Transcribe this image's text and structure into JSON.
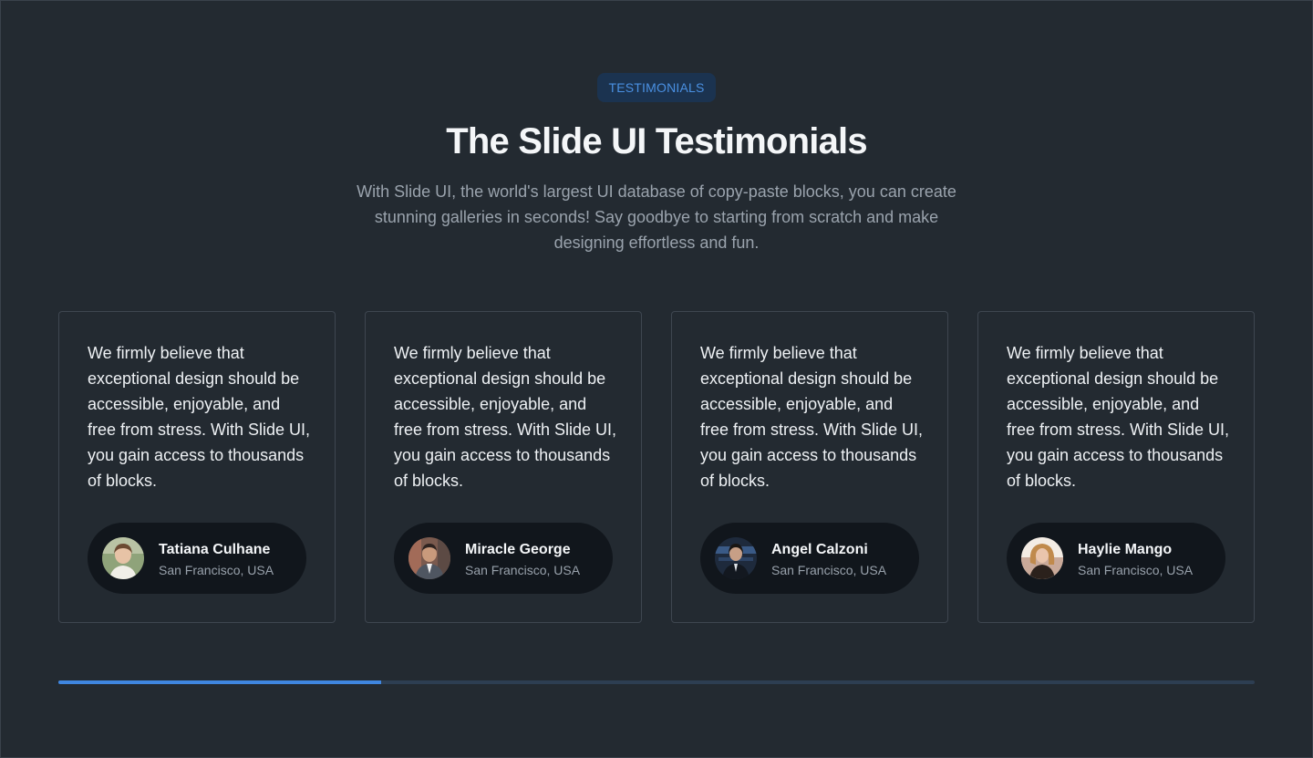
{
  "section": {
    "badge": "TESTIMONIALS",
    "title": "The Slide UI Testimonials",
    "subtitle": "With Slide UI, the world's largest UI database of copy-paste blocks, you can create stunning galleries in seconds! Say goodbye to starting from scratch and make designing effortless and fun."
  },
  "testimonials": [
    {
      "quote": "We firmly believe that exceptional design should be accessible, enjoyable, and free from stress. With Slide UI, you gain access to thousands of blocks.",
      "name": "Tatiana Culhane",
      "location": "San Francisco, USA",
      "avatar_icon": "avatar-photo"
    },
    {
      "quote": "We firmly believe that exceptional design should be accessible, enjoyable, and free from stress. With Slide UI, you gain access to thousands of blocks.",
      "name": "Miracle George",
      "location": "San Francisco, USA",
      "avatar_icon": "avatar-photo"
    },
    {
      "quote": "We firmly believe that exceptional design should be accessible, enjoyable, and free from stress. With Slide UI, you gain access to thousands of blocks.",
      "name": "Angel Calzoni",
      "location": "San Francisco, USA",
      "avatar_icon": "avatar-photo"
    },
    {
      "quote": "We firmly believe that exceptional design should be accessible, enjoyable, and free from stress. With Slide UI, you gain access to thousands of blocks.",
      "name": "Haylie Mango",
      "location": "San Francisco, USA",
      "avatar_icon": "avatar-photo"
    }
  ],
  "slider": {
    "progress": 0.27
  },
  "colors": {
    "background": "#232a31",
    "accent": "#3f86e0",
    "badge_bg": "#1b3350",
    "badge_text": "#4a90e2",
    "author_pill": "#11161c"
  }
}
